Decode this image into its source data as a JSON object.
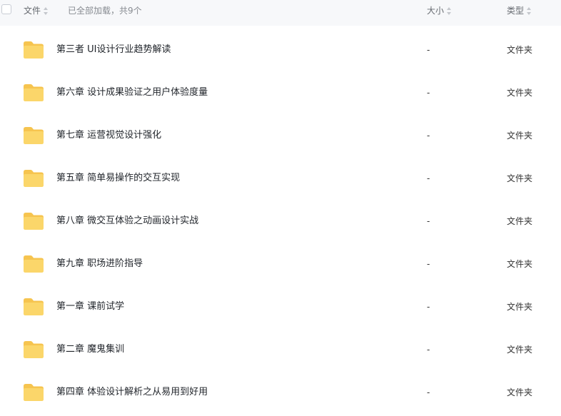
{
  "header": {
    "name_label": "文件",
    "summary": "已全部加载，共9个",
    "size_label": "大小",
    "type_label": "类型"
  },
  "colors": {
    "folder_back": "#f6c44f",
    "folder_front": "#fbd66a",
    "header_bg": "#f7f8fa"
  },
  "files": [
    {
      "name": "第三者 UI设计行业趋势解读",
      "size": "-",
      "type": "文件夹",
      "icon": "folder-icon"
    },
    {
      "name": "第六章 设计成果验证之用户体验度量",
      "size": "-",
      "type": "文件夹",
      "icon": "folder-icon"
    },
    {
      "name": "第七章 运营视觉设计强化",
      "size": "-",
      "type": "文件夹",
      "icon": "folder-icon"
    },
    {
      "name": "第五章 简单易操作的交互实现",
      "size": "-",
      "type": "文件夹",
      "icon": "folder-icon"
    },
    {
      "name": "第八章 微交互体验之动画设计实战",
      "size": "-",
      "type": "文件夹",
      "icon": "folder-icon"
    },
    {
      "name": "第九章 职场进阶指导",
      "size": "-",
      "type": "文件夹",
      "icon": "folder-icon"
    },
    {
      "name": "第一章 课前试学",
      "size": "-",
      "type": "文件夹",
      "icon": "folder-icon"
    },
    {
      "name": "第二章 魔鬼集训",
      "size": "-",
      "type": "文件夹",
      "icon": "folder-icon"
    },
    {
      "name": "第四章 体验设计解析之从易用到好用",
      "size": "-",
      "type": "文件夹",
      "icon": "folder-icon"
    }
  ]
}
